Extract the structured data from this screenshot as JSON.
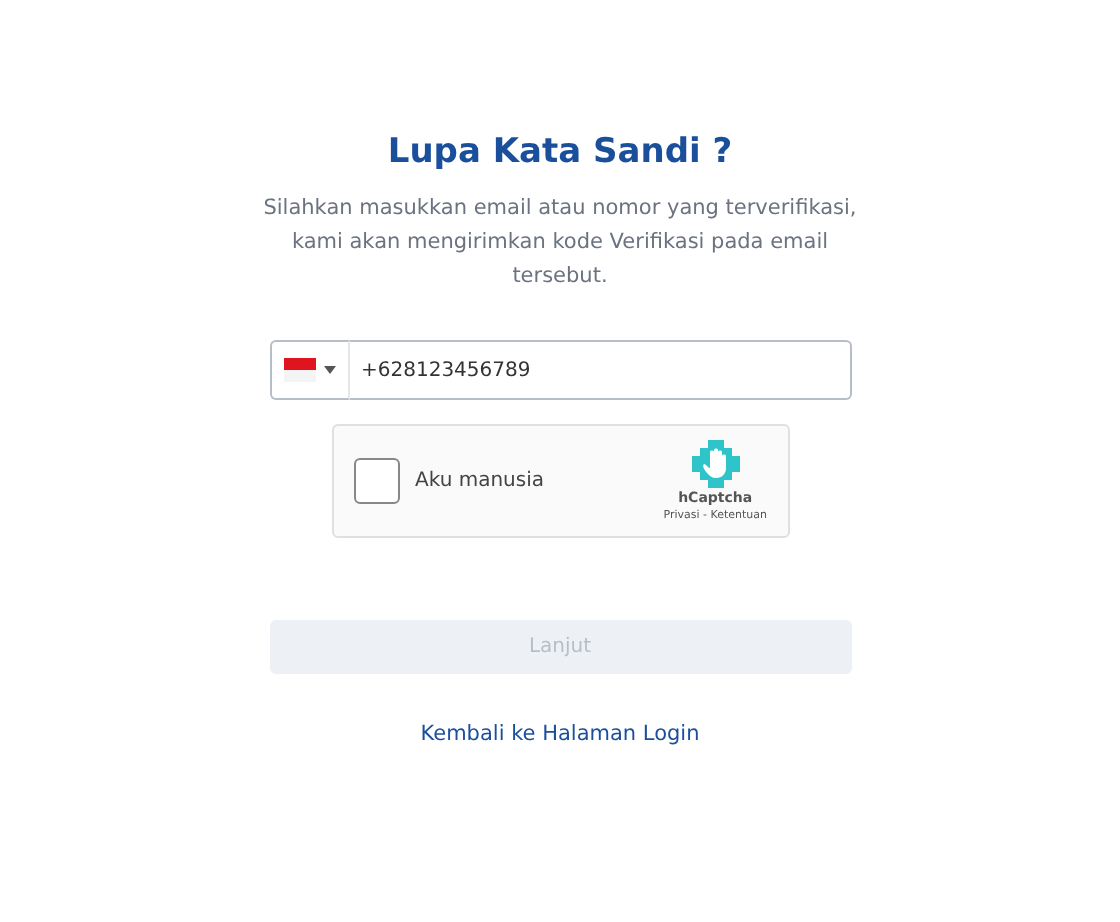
{
  "title": "Lupa Kata Sandi ?",
  "description": "Silahkan masukkan email atau nomor yang terverifikasi, kami akan mengirimkan kode Verifikasi pada email tersebut.",
  "phone": {
    "value": "+628123456789"
  },
  "captcha": {
    "label": "Aku manusia",
    "checked": false,
    "brand": "hCaptcha",
    "links": "Privasi - Ketentuan"
  },
  "submit": {
    "label": "Lanjut",
    "disabled": true
  },
  "back_link": "Kembali ke Halaman Login"
}
